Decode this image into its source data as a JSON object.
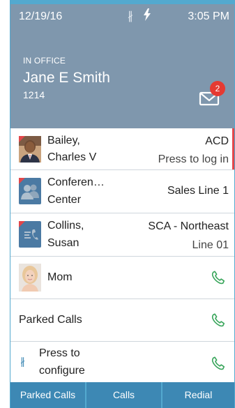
{
  "status": {
    "date": "12/19/16",
    "time": "3:05 PM",
    "bluetooth_icon": "bluetooth-icon",
    "charging_icon": "lightning-bolt-icon"
  },
  "header": {
    "line_state": "IN OFFICE",
    "user_name": "Jane E Smith",
    "extension": "1214",
    "messages_icon": "envelope-icon",
    "message_count": "2"
  },
  "lines": [
    {
      "name_line1": "Bailey,",
      "name_line2": "Charles V",
      "right_top": "ACD",
      "right_bottom": "Press to log in",
      "icon": "photo-avatar"
    },
    {
      "name_line1": "Conferen…",
      "name_line2": "Center",
      "right_top": "Sales Line 1",
      "icon": "group-avatar-icon"
    },
    {
      "name_line1": "Collins,",
      "name_line2": "Susan",
      "right_top": "SCA - Northeast",
      "right_bottom": "Line 01",
      "icon": "shared-line-icon"
    },
    {
      "name": "Mom",
      "icon": "photo-avatar"
    },
    {
      "name": "Parked Calls",
      "icon": "phone-icon"
    },
    {
      "name_line1": "Press to",
      "name_line2": "configure",
      "icon": "bluetooth-icon"
    }
  ],
  "softkeys": [
    "Parked Calls",
    "Calls",
    "Redial"
  ],
  "colors": {
    "header_bg": "#7f97ad",
    "accent_blue": "#53a9cf",
    "softkey_bg": "#3d88b4",
    "alert_red": "#e2464a",
    "call_green": "#3aa65c",
    "badge_red": "#e53a32"
  }
}
